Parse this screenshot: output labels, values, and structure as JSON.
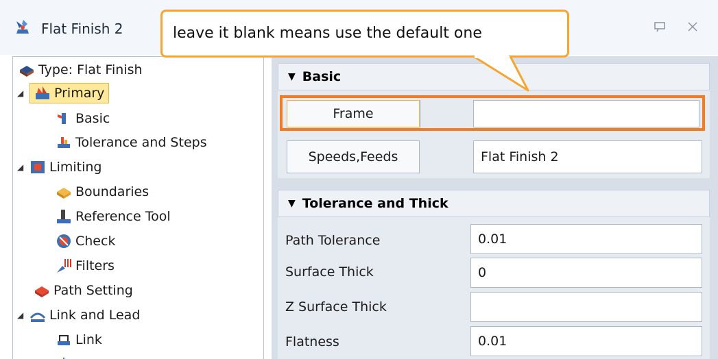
{
  "window": {
    "title": "Flat Finish 2",
    "icons": {
      "app": "flat-finish-icon",
      "pin": "pin-icon",
      "close": "close-icon"
    }
  },
  "callout": {
    "text": "leave it blank means use the default one",
    "border_color": "#f7a531"
  },
  "tree": {
    "items": [
      {
        "label": "Type: Flat Finish",
        "icon": "type-icon"
      },
      {
        "label": "Primary",
        "icon": "primary-icon",
        "selected": true
      },
      {
        "label": "Basic",
        "icon": "basic-icon"
      },
      {
        "label": "Tolerance and Steps",
        "icon": "tolerance-steps-icon"
      },
      {
        "label": "Limiting",
        "icon": "limiting-icon"
      },
      {
        "label": "Boundaries",
        "icon": "boundaries-icon"
      },
      {
        "label": "Reference Tool",
        "icon": "reference-tool-icon"
      },
      {
        "label": "Check",
        "icon": "check-icon"
      },
      {
        "label": "Filters",
        "icon": "filters-icon"
      },
      {
        "label": "Path Setting",
        "icon": "path-setting-icon"
      },
      {
        "label": "Link and Lead",
        "icon": "link-lead-icon"
      },
      {
        "label": "Link",
        "icon": "link-icon"
      }
    ]
  },
  "basic": {
    "header": "Basic",
    "frame_label": "Frame",
    "frame_value": "",
    "speeds_label": "Speeds,Feeds",
    "speeds_value": "Flat Finish 2"
  },
  "tolerance": {
    "header": "Tolerance and Thick",
    "rows": [
      {
        "label": "Path Tolerance",
        "value": "0.01"
      },
      {
        "label": "Surface Thick",
        "value": "0"
      },
      {
        "label": "Z Surface Thick",
        "value": ""
      },
      {
        "label": "Flatness",
        "value": "0.01"
      }
    ]
  },
  "colors": {
    "highlight": "#f47b20",
    "selection": "#ffe99a"
  }
}
